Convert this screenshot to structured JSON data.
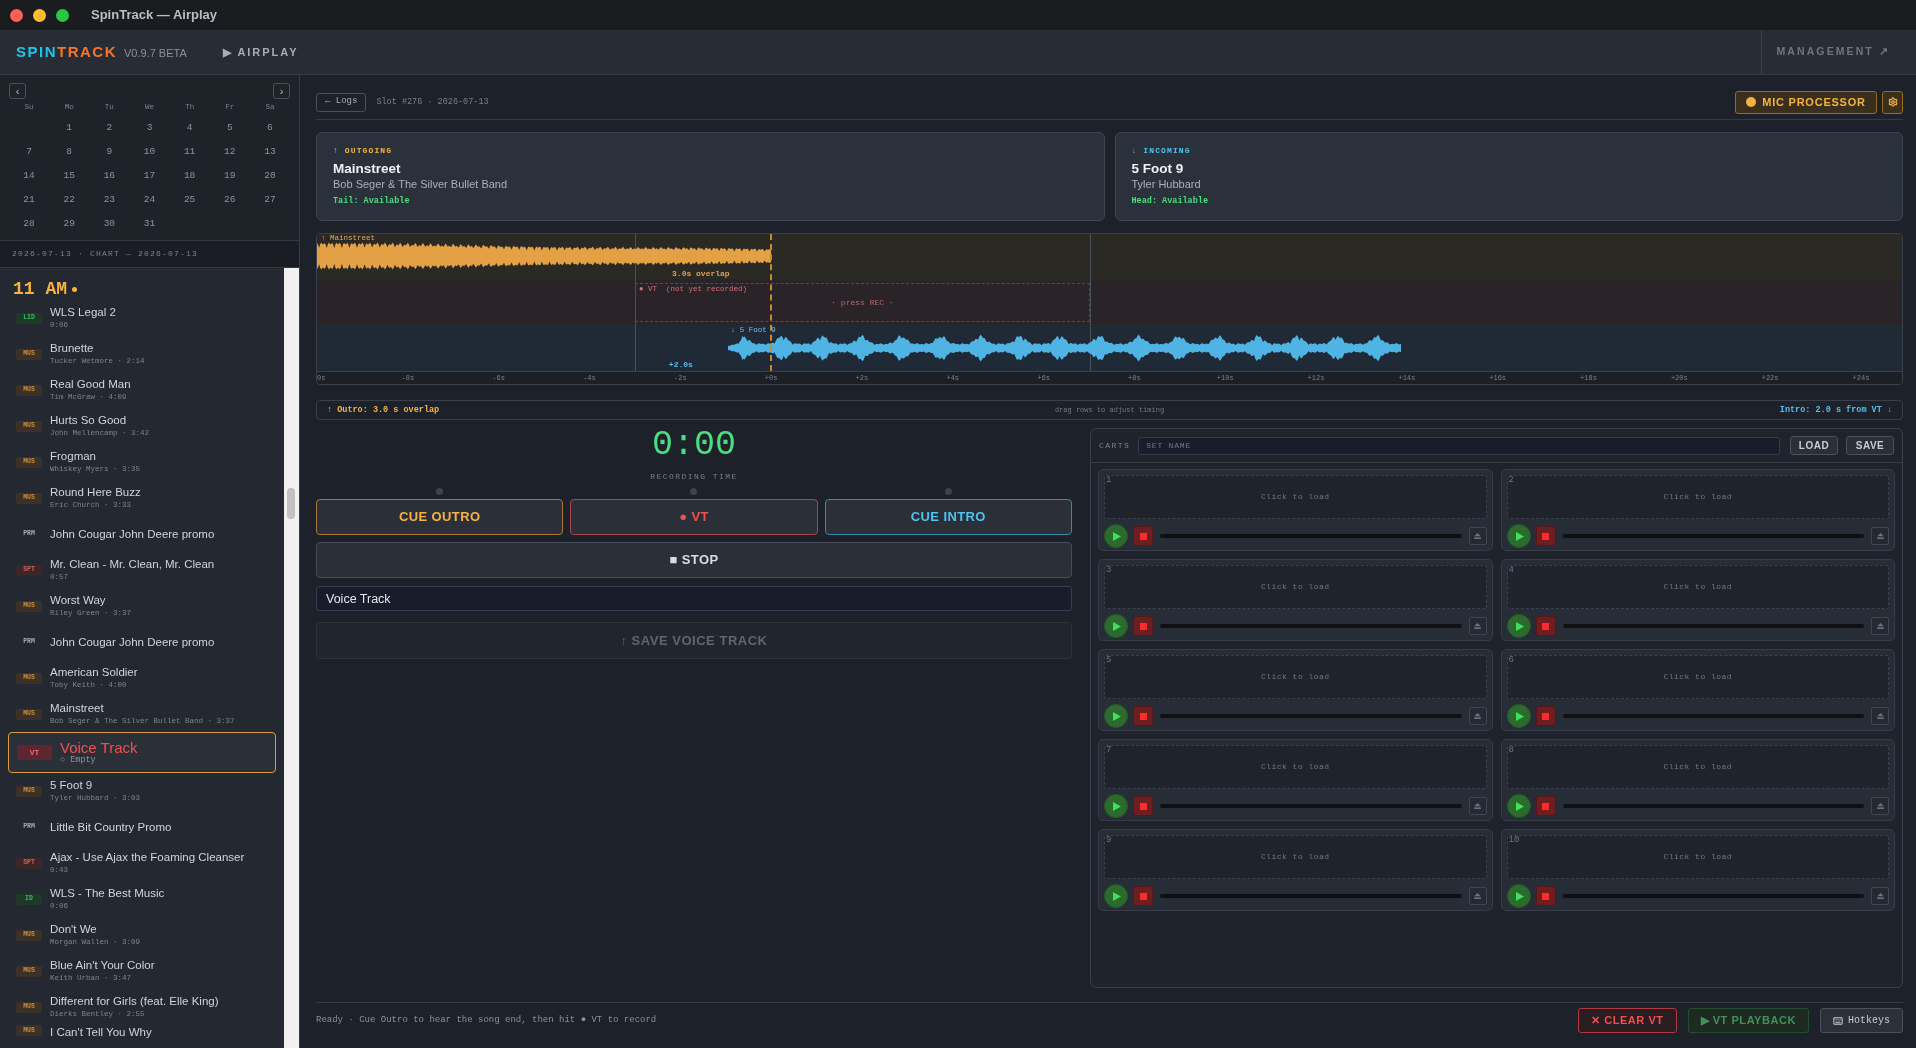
{
  "window": {
    "title": "SpinTrack — Airplay"
  },
  "header": {
    "logo": {
      "first": "SPIN",
      "second": "TRACK"
    },
    "version": "V0.9.7 BETA",
    "airplay": "▶ AIRPLAY",
    "management": "MANAGEMENT ↗"
  },
  "calendar": {
    "prev": "‹",
    "next": "›",
    "weekdays": [
      "Su",
      "Mo",
      "Tu",
      "We",
      "Th",
      "Fr",
      "Sa"
    ],
    "weeks": [
      [
        "1",
        "2",
        "3",
        "4",
        "5",
        "6"
      ],
      [
        "7",
        "8",
        "9",
        "10",
        "11",
        "12",
        "13"
      ],
      [
        "14",
        "15",
        "16",
        "17",
        "18",
        "19",
        "20"
      ],
      [
        "21",
        "22",
        "23",
        "24",
        "25",
        "26",
        "27"
      ],
      [
        "28",
        "29",
        "30",
        "31"
      ]
    ]
  },
  "chart_range": "2026-07-13 · CHART — 2026-07-13",
  "log": {
    "hour": "11 AM",
    "items": [
      {
        "kind": "liner",
        "tag": "LID",
        "title": "WLS Legal 2",
        "subtitle": "0:06",
        "selected": false
      },
      {
        "kind": "music",
        "tag": "MUS",
        "title": "Brunette",
        "subtitle": "Tucker Wetmore · 2:14",
        "selected": false
      },
      {
        "kind": "music",
        "tag": "MUS",
        "title": "Real Good Man",
        "subtitle": "Tim McGraw · 4:09",
        "selected": false
      },
      {
        "kind": "music",
        "tag": "MUS",
        "title": "Hurts So Good",
        "subtitle": "John Mellencamp · 3:42",
        "selected": false
      },
      {
        "kind": "music",
        "tag": "MUS",
        "title": "Frogman",
        "subtitle": "Whiskey Myers · 3:35",
        "selected": false
      },
      {
        "kind": "music",
        "tag": "MUS",
        "title": "Round Here Buzz",
        "subtitle": "Eric Church · 3:33",
        "selected": false
      },
      {
        "kind": "promo",
        "tag": "PRM",
        "title": "John Cougar John Deere promo",
        "selected": false
      },
      {
        "kind": "spot",
        "tag": "SPT",
        "title": "Mr. Clean - Mr. Clean, Mr. Clean",
        "subtitle": "0:57",
        "selected": false
      },
      {
        "kind": "music",
        "tag": "MUS",
        "title": "Worst Way",
        "subtitle": "Riley Green · 3:37",
        "selected": false
      },
      {
        "kind": "promo",
        "tag": "PRM",
        "title": "John Cougar John Deere promo",
        "selected": false
      },
      {
        "kind": "music",
        "tag": "MUS",
        "title": "American Soldier",
        "subtitle": "Toby Keith · 4:00",
        "selected": false
      },
      {
        "kind": "music",
        "tag": "MUS",
        "title": "Mainstreet",
        "subtitle": "Bob Seger & The Silver Bullet Band · 3:37",
        "selected": false
      },
      {
        "kind": "voicetrack",
        "tag": "VT",
        "title": "Voice Track",
        "subtitle": "○ Empty",
        "selected": true
      },
      {
        "kind": "music",
        "tag": "MUS",
        "title": "5 Foot 9",
        "subtitle": "Tyler Hubbard · 3:03",
        "selected": false
      },
      {
        "kind": "promo",
        "tag": "PRM",
        "title": "Little Bit Country Promo",
        "selected": false
      },
      {
        "kind": "spot",
        "tag": "SPT",
        "title": "Ajax - Use Ajax the Foaming Cleanser",
        "subtitle": "0:43",
        "selected": false
      },
      {
        "kind": "id",
        "tag": "ID",
        "title": "WLS - The Best Music",
        "subtitle": "0:06",
        "selected": false
      },
      {
        "kind": "music",
        "tag": "MUS",
        "title": "Don't We",
        "subtitle": "Morgan Wallen · 3:09",
        "selected": false
      },
      {
        "kind": "music",
        "tag": "MUS",
        "title": "Blue Ain't Your Color",
        "subtitle": "Keith Urban · 3:47",
        "selected": false
      },
      {
        "kind": "music",
        "tag": "MUS",
        "title": "Different for Girls (feat. Elle King)",
        "subtitle": "Dierks Bentley · 2:55",
        "selected": false
      },
      {
        "kind": "music",
        "tag": "MUS",
        "title": "I Can't Tell You Why",
        "selected": false
      }
    ]
  },
  "toolbar": {
    "back": "← Logs",
    "slot": "Slot #276 · 2026-07-13",
    "mic_processor": "MIC PROCESSOR"
  },
  "transition": [
    {
      "kind": "outgoing",
      "label": "↑ OUTGOING",
      "title": "Mainstreet",
      "artist": "Bob Seger & The Silver Bullet Band",
      "status": "Tail: Available"
    },
    {
      "kind": "incoming",
      "label": "↓ INCOMING",
      "title": "5 Foot 9",
      "artist": "Tyler Hubbard",
      "status": "Head: Available"
    }
  ],
  "timeline": {
    "outgoing_label": "↑ Mainstreet",
    "overlap": "3.0s overlap",
    "vt_label": "● VT  (not yet recorded)",
    "vt_hint": "· press REC ·",
    "incoming_label": "↓ 5 Foot 9",
    "offset": "+2.0s",
    "ticks": [
      "0s",
      "-8s",
      "-6s",
      "-4s",
      "-2s",
      "+0s",
      "+2s",
      "+4s",
      "+6s",
      "+8s",
      "+10s",
      "+12s",
      "+14s",
      "+16s",
      "+18s",
      "+20s",
      "+22s",
      "+24s"
    ],
    "footer": {
      "left": "↑ Outro: 3.0 s overlap",
      "center": "drag rows to adjust timing",
      "right": "Intro: 2.0 s from VT ↓"
    }
  },
  "recorder": {
    "time": "0:00",
    "time_label": "RECORDING TIME",
    "buttons": [
      {
        "kind": "cue_outro",
        "label": "CUE OUTRO",
        "lit": false
      },
      {
        "kind": "record",
        "label": "● VT",
        "lit": false
      },
      {
        "kind": "cue_intro",
        "label": "CUE INTRO",
        "lit": false
      }
    ],
    "stop": "■ STOP",
    "name_field": {
      "value": "Voice Track"
    },
    "save": {
      "label": "↑ SAVE VOICE TRACK",
      "disabled": true
    }
  },
  "carts": {
    "title": "CARTS",
    "set_name": {
      "placeholder": "SET NAME"
    },
    "load": "LOAD",
    "save": "SAVE",
    "slots": [
      {
        "number": "1",
        "label": "Click to load",
        "level": 0
      },
      {
        "number": "2",
        "label": "Click to load",
        "level": 0
      },
      {
        "number": "3",
        "label": "Click to load",
        "level": 0
      },
      {
        "number": "4",
        "label": "Click to load",
        "level": 0
      },
      {
        "number": "5",
        "label": "Click to load",
        "level": 0
      },
      {
        "number": "6",
        "label": "Click to load",
        "level": 0
      },
      {
        "number": "7",
        "label": "Click to load",
        "level": 0
      },
      {
        "number": "8",
        "label": "Click to load",
        "level": 0
      },
      {
        "number": "9",
        "label": "Click to load",
        "level": 0
      },
      {
        "number": "10",
        "label": "Click to load",
        "level": 0
      }
    ]
  },
  "status_bar": {
    "message": "Ready · Cue Outro to hear the song end, then hit ● VT to record",
    "buttons": [
      {
        "kind": "clear",
        "label": "✕ CLEAR VT",
        "disabled": false
      },
      {
        "kind": "playback",
        "label": "▶ VT PLAYBACK",
        "disabled": true
      },
      {
        "kind": "hotkeys",
        "label": "Hotkeys",
        "disabled": false
      }
    ]
  }
}
